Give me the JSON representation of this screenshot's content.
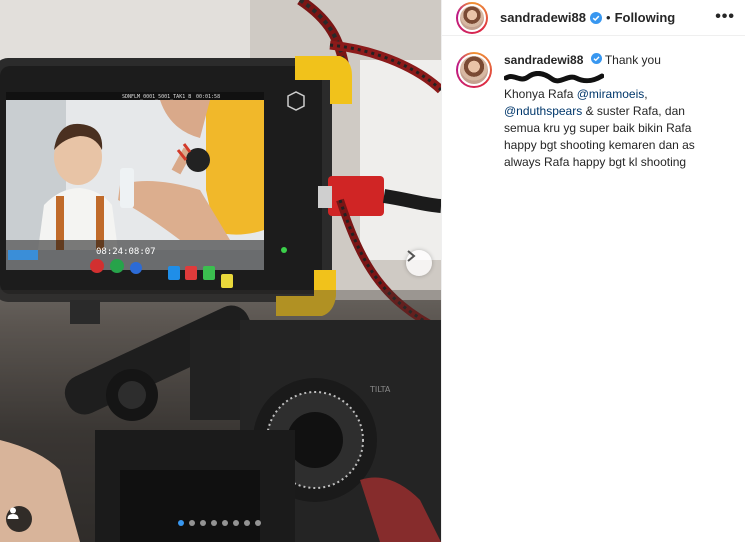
{
  "post": {
    "image_alt": "Behind the scenes camera rig with monitor showing a child and a woman",
    "carousel_dots": 8,
    "active_dot": 0
  },
  "monitor": {
    "filename": "SDNFLM_0001_5001_TAK1_B",
    "timecode": "00:01:58",
    "overlay_time": "08:24:08:07"
  },
  "header": {
    "username": "sandradewi88",
    "separator": "•",
    "follow_label": "Following",
    "more_label": "•••"
  },
  "caption": {
    "username": "sandradewi88",
    "lines": {
      "l1": "Thank you",
      "l2_text": "Khonya Rafa ",
      "l2_mention": "@miramoeis",
      "l2_tail": ",",
      "l3_mention": "@nduthspears",
      "l3_text": " & suster Rafa, dan",
      "l4": "semua kru yg super baik bikin Rafa",
      "l5": "happy bgt shooting kemaren dan as",
      "l6": "always Rafa happy bgt kl shooting"
    }
  },
  "colors": {
    "accent": "#3897f0",
    "mention": "#00376b",
    "verified": "#3897f0"
  }
}
